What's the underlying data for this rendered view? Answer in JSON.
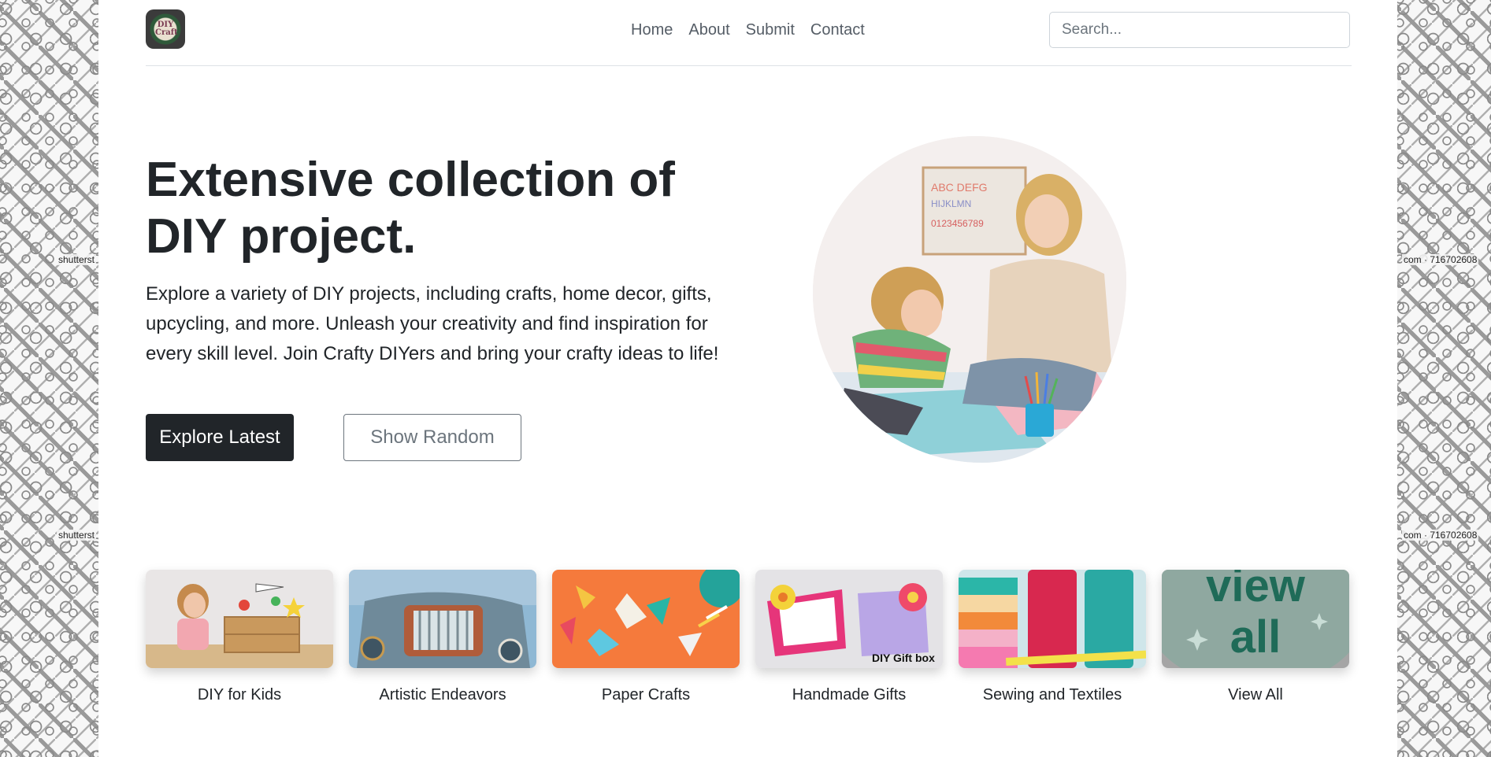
{
  "header": {
    "logo_text": "DIY Craft",
    "nav": [
      "Home",
      "About",
      "Submit",
      "Contact"
    ],
    "search_placeholder": "Search..."
  },
  "hero": {
    "title": "Extensive collection of DIY project.",
    "description": "Explore a variety of DIY projects, including crafts, home decor, gifts, upcycling, and more. Unleash your creativity and find inspiration for every skill level. Join Crafty DIYers and bring your crafty ideas to life!",
    "primary_button": "Explore Latest",
    "secondary_button": "Show Random"
  },
  "categories": [
    {
      "label": "DIY for Kids"
    },
    {
      "label": "Artistic Endeavors"
    },
    {
      "label": "Paper Crafts"
    },
    {
      "label": "Handmade Gifts",
      "image_text": "DIY Gift box"
    },
    {
      "label": "Sewing and Textiles"
    },
    {
      "label": "View All",
      "image_text": "view all"
    }
  ],
  "background_watermark": [
    "shutterst",
    "com · 716702608"
  ],
  "colors": {
    "dark": "#212529",
    "muted": "#6c757d",
    "view_all_bg": "#8fa8a0",
    "view_all_text": "#1f6b58"
  }
}
